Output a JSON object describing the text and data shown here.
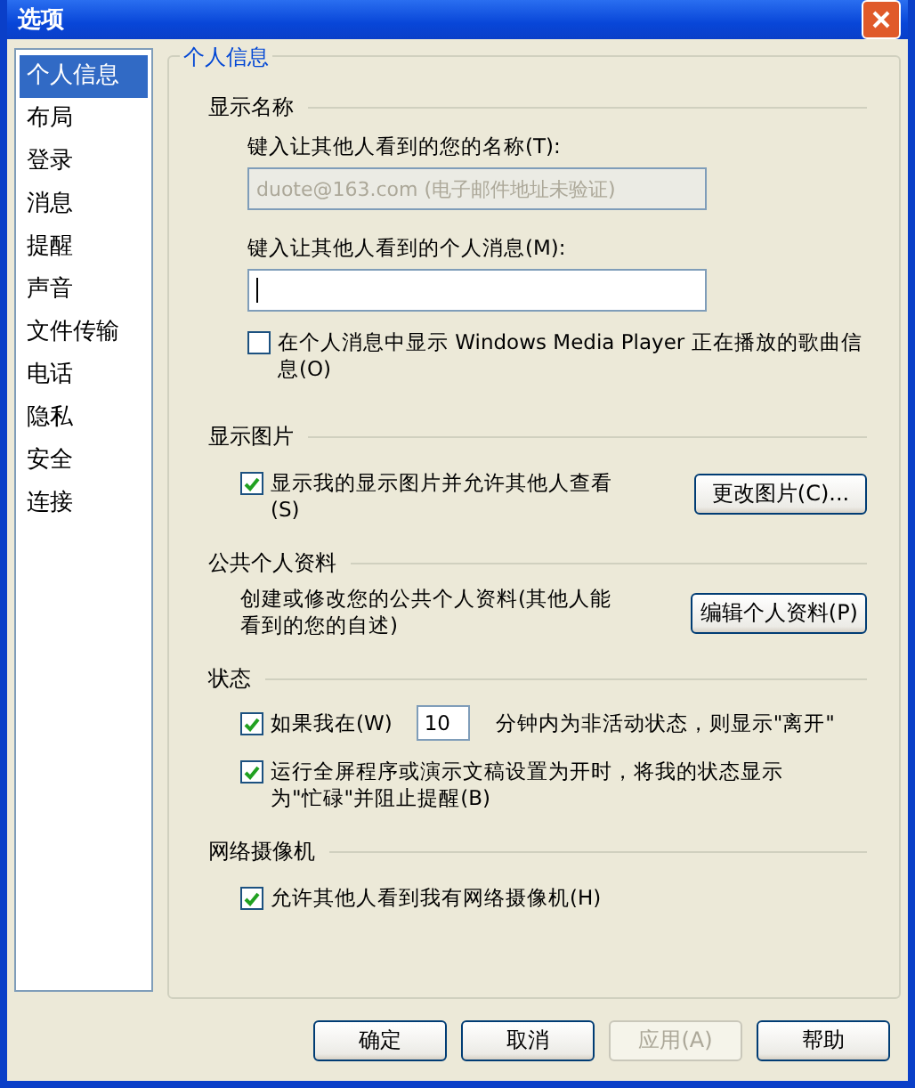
{
  "window": {
    "title": "选项"
  },
  "sidebar": {
    "items": [
      {
        "label": "个人信息",
        "selected": true
      },
      {
        "label": "布局",
        "selected": false
      },
      {
        "label": "登录",
        "selected": false
      },
      {
        "label": "消息",
        "selected": false
      },
      {
        "label": "提醒",
        "selected": false
      },
      {
        "label": "声音",
        "selected": false
      },
      {
        "label": "文件传输",
        "selected": false
      },
      {
        "label": "电话",
        "selected": false
      },
      {
        "label": "隐私",
        "selected": false
      },
      {
        "label": "安全",
        "selected": false
      },
      {
        "label": "连接",
        "selected": false
      }
    ]
  },
  "panel_title": "个人信息",
  "display_name": {
    "heading": "显示名称",
    "name_label": "键入让其他人看到的您的名称(T):",
    "name_value": "duote@163.com (电子邮件地址未验证)",
    "name_disabled": true,
    "message_label": "键入让其他人看到的个人消息(M):",
    "checkbox": {
      "label": "在个人消息中显示 Windows Media Player 正在播放的歌曲信息(O)",
      "checked": false
    }
  },
  "display_picture": {
    "heading": "显示图片",
    "checkbox": {
      "label": "显示我的显示图片并允许其他人查看(S)",
      "checked": true
    },
    "button": "更改图片(C)..."
  },
  "public_profile": {
    "heading": "公共个人资料",
    "description": "创建或修改您的公共个人资料(其他人能看到的您的自述)",
    "button": "编辑个人资料(P)"
  },
  "status": {
    "heading": "状态",
    "idle": {
      "label": "如果我在(W)",
      "checked": true,
      "minutes": "10",
      "suffix": "分钟内为非活动状态，则显示\"离开\""
    },
    "fullscreen": {
      "label": "运行全屏程序或演示文稿设置为开时，将我的状态显示为\"忙碌\"并阻止提醒(B)",
      "checked": true
    }
  },
  "webcam": {
    "heading": "网络摄像机",
    "checkbox": {
      "label": "允许其他人看到我有网络摄像机(H)",
      "checked": true
    }
  },
  "buttons": [
    {
      "label": "确定",
      "disabled": false
    },
    {
      "label": "取消",
      "disabled": false
    },
    {
      "label": "应用(A)",
      "disabled": true
    },
    {
      "label": "帮助",
      "disabled": false
    }
  ]
}
